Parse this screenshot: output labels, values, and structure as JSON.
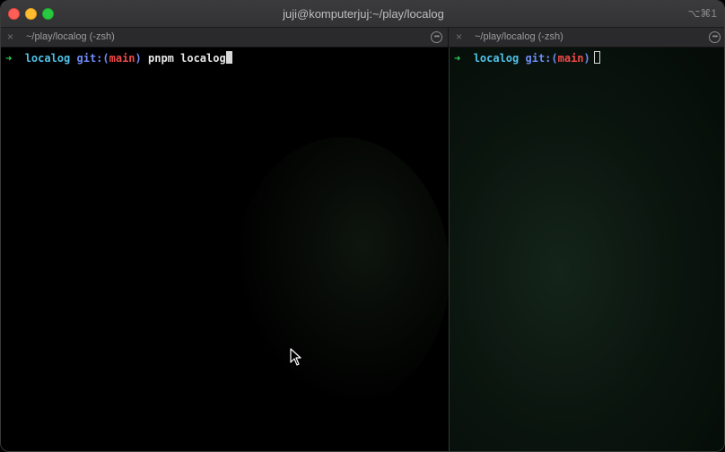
{
  "window": {
    "title": "juji@komputerjuj:~/play/localog",
    "shortcut": "⌥⌘1"
  },
  "tabs": [
    {
      "label": "~/play/localog (-zsh)",
      "close_icon": "×",
      "menu_icon": "•••"
    },
    {
      "label": "~/play/localog (-zsh)",
      "close_icon": "×",
      "menu_icon": "•••"
    }
  ],
  "panes": [
    {
      "prompt_arrow": "➜",
      "directory": "localog",
      "git_prefix": "git:(",
      "branch": "main",
      "git_suffix": ")",
      "command": "pnpm localog",
      "cursor": "block"
    },
    {
      "prompt_arrow": "➜",
      "directory": "localog",
      "git_prefix": "git:(",
      "branch": "main",
      "git_suffix": ")",
      "command": "",
      "cursor": "hollow"
    }
  ],
  "colors": {
    "arrow": "#2fd158",
    "directory": "#4fc3e8",
    "git": "#6f8cf5",
    "branch": "#f04848"
  }
}
